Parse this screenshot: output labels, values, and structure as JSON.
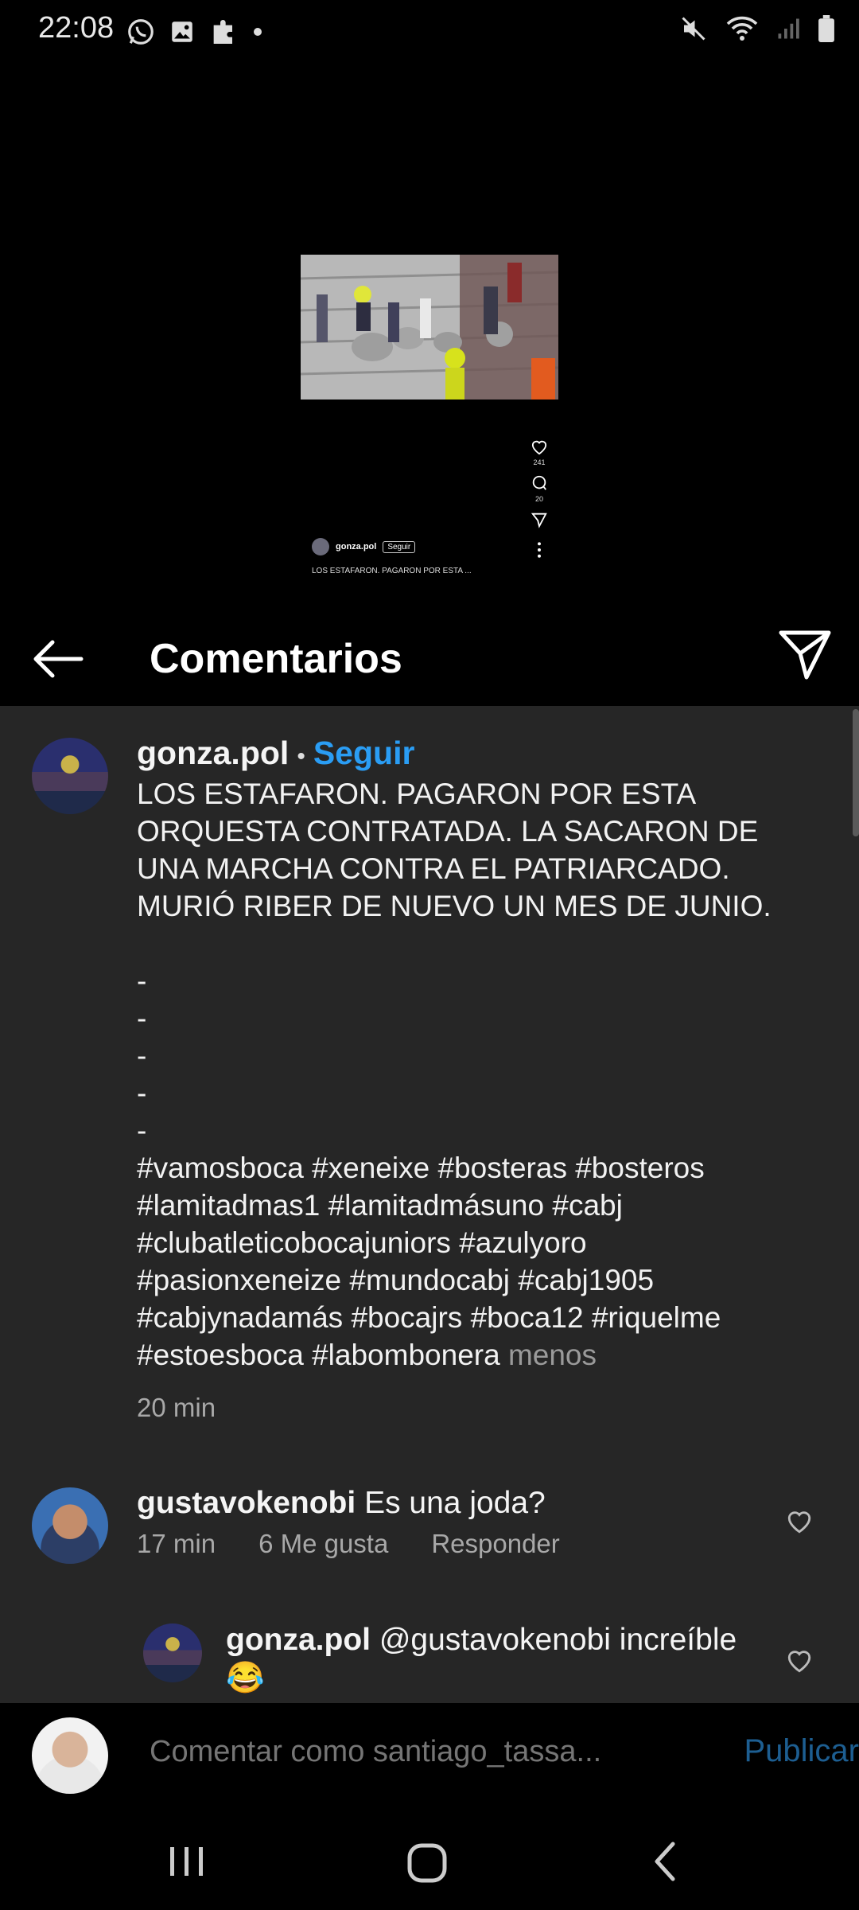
{
  "status_bar": {
    "time": "22:08"
  },
  "video": {
    "mini_likes": "241",
    "mini_comments": "20",
    "mini_username": "gonza.pol",
    "mini_follow": "Seguir",
    "mini_caption": "LOS ESTAFARON. PAGARON POR ESTA ..."
  },
  "header": {
    "title": "Comentarios"
  },
  "caption": {
    "username": "gonza.pol",
    "follow": "Seguir",
    "text": "LOS ESTAFARON. PAGARON POR ESTA ORQUESTA CONTRATADA. LA SACARON DE UNA MARCHA CONTRA EL PATRIARCADO. MURIÓ RIBER DE NUEVO UN MES DE JUNIO.\n\n-\n-\n-\n-\n-\n#vamosboca #xeneixe #bosteras #bosteros #lamitadmas1 #lamitadmásuno #cabj #clubatleticobocajuniors #azulyoro #pasionxeneize #mundocabj #cabj1905 #cabjynadamás #bocajrs #boca12 #riquelme #estoesboca #labombonera",
    "more": "menos",
    "time": "20 min"
  },
  "comments": [
    {
      "username": "gustavokenobi",
      "text": "Es una joda?",
      "time": "17 min",
      "likes": "6 Me gusta",
      "reply": "Responder"
    },
    {
      "username": "gonza.pol",
      "text": "@gustavokenobi increíble 😂"
    }
  ],
  "composer": {
    "placeholder": "Comentar como santiago_tassa...",
    "publish": "Publicar"
  },
  "colors": {
    "accent": "#2a9df4",
    "panel": "#262626",
    "publish_disabled": "#1d5e91"
  }
}
